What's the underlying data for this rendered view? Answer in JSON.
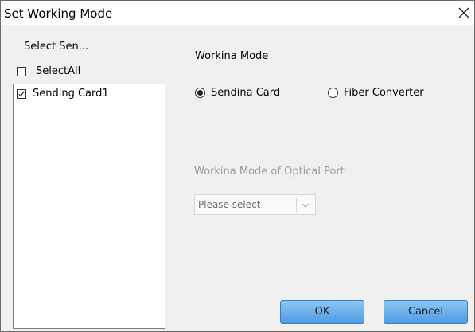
{
  "window": {
    "title": "Set Working Mode"
  },
  "left_panel": {
    "label": "Select Sen...",
    "select_all": {
      "label": "SelectAll",
      "checked": false
    },
    "cards": [
      {
        "label": "Sending Card1",
        "checked": true
      }
    ]
  },
  "working_mode": {
    "label": "Workina Mode",
    "options": [
      {
        "label": "Sendina Card",
        "selected": true
      },
      {
        "label": "Fiber Converter",
        "selected": false
      }
    ]
  },
  "optical_port": {
    "label": "Workina Mode of Optical Port",
    "select_value": "Please select"
  },
  "buttons": {
    "ok": "OK",
    "cancel": "Cancel"
  },
  "colors": {
    "button_top": "#8dc4f1",
    "button_bottom": "#4e9ce4",
    "disabled_text": "#9c9c9c"
  },
  "icons": {
    "close": "close-icon",
    "chevron": "chevron-down-icon",
    "check": "check-icon"
  }
}
